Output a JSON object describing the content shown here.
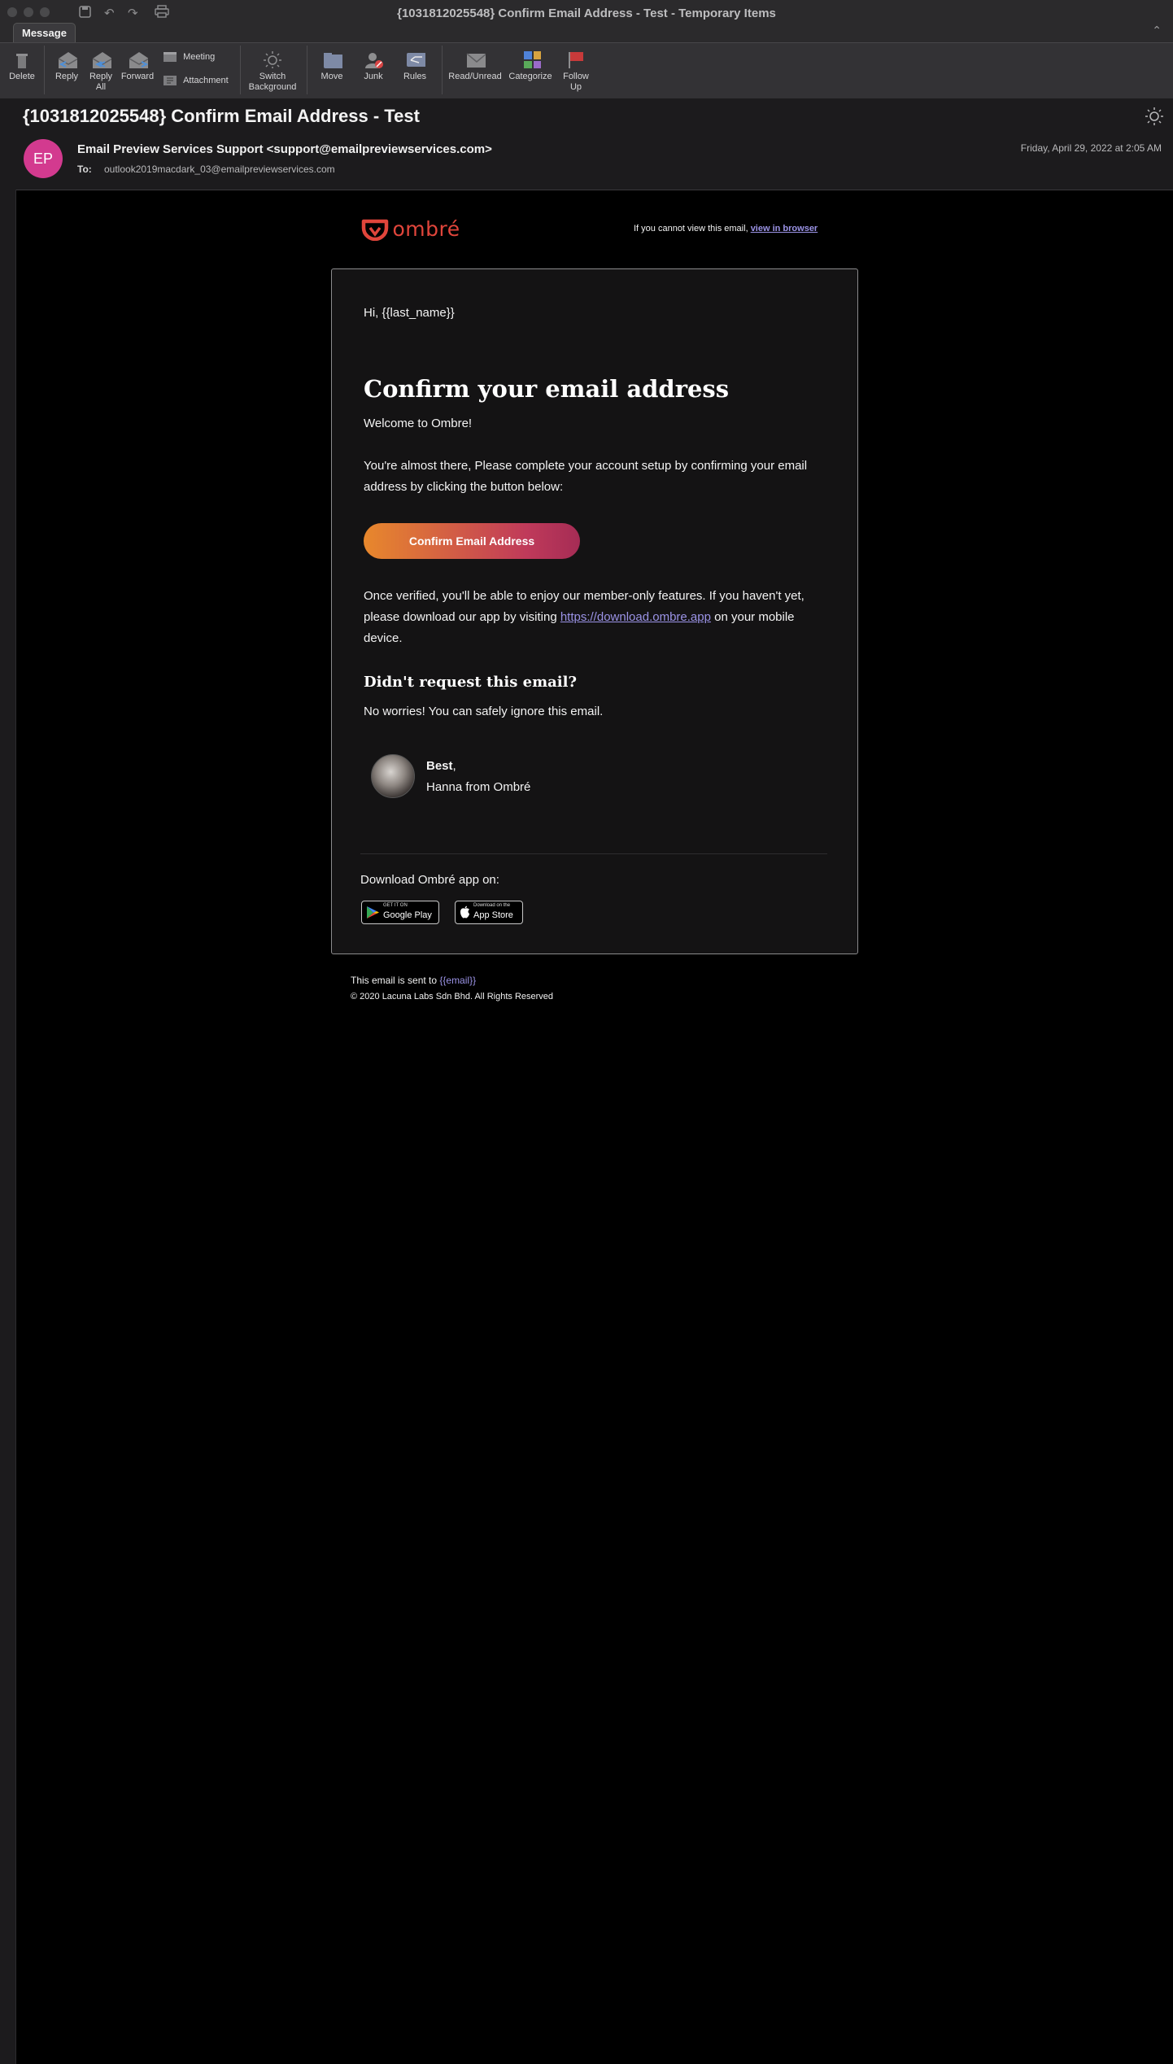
{
  "window": {
    "title": "{1031812025548} Confirm Email Address - Test - Temporary Items",
    "active_tab": "Message"
  },
  "ribbon": {
    "delete": "Delete",
    "reply": "Reply",
    "reply_all_1": "Reply",
    "reply_all_2": "All",
    "forward": "Forward",
    "meeting": "Meeting",
    "attachment": "Attachment",
    "switch_bg_1": "Switch",
    "switch_bg_2": "Background",
    "move": "Move",
    "junk": "Junk",
    "rules": "Rules",
    "read_unread": "Read/Unread",
    "categorize": "Categorize",
    "follow_up_1": "Follow",
    "follow_up_2": "Up"
  },
  "message": {
    "subject": "{1031812025548} Confirm Email Address - Test",
    "avatar_initials": "EP",
    "avatar_color": "#d33a8f",
    "sender": "Email Preview Services Support <support@emailpreviewservices.com>",
    "to_label": "To:",
    "to": "outlook2019macdark_03@emailpreviewservices.com",
    "date": "Friday, April 29, 2022 at 2:05 AM"
  },
  "email": {
    "logo_text": "ombré",
    "brand_color": "#e0453b",
    "cant_view": "If you cannot view this email, ",
    "view_in_browser": "view in browser",
    "greeting": "Hi, {{last_name}}",
    "headline": "Confirm your email address",
    "welcome": "Welcome to Ombre!",
    "almost_there": "You're almost there, Please complete your account setup by confirming your email address by clicking the button below:",
    "cta": "Confirm Email Address",
    "verified_pre": "Once verified, you'll be able to enjoy our member-only features. If you haven't yet, please download our app by visiting ",
    "verified_link": "https://download.ombre.app",
    "verified_post": " on your mobile device.",
    "didnt_request": "Didn't request this email?",
    "no_worries": "No worries! You can safely ignore this email.",
    "best": "Best",
    "best_suffix": ",",
    "signoff_name": "Hanna from Ombré",
    "download_label": "Download Ombré app on:",
    "google_play_small": "GET IT ON",
    "google_play_big": "Google Play",
    "app_store_small": "Download on the",
    "app_store_big": "App Store",
    "sent_to": "This email is sent to ",
    "sent_to_email": "{{email}}",
    "copyright": "© 2020 Lacuna Labs Sdn Bhd. All Rights Reserved"
  }
}
